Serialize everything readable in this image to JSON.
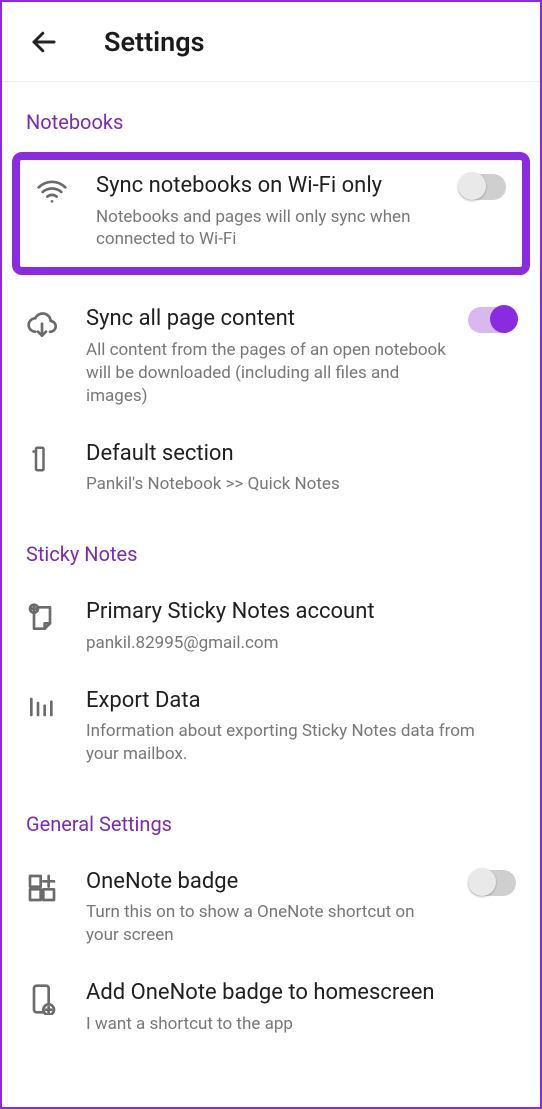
{
  "header": {
    "title": "Settings"
  },
  "sections": {
    "notebooks": {
      "header": "Notebooks",
      "sync_wifi": {
        "title": "Sync notebooks on Wi-Fi only",
        "sub": "Notebooks and pages will only sync when connected to Wi-Fi",
        "on": false
      },
      "sync_all": {
        "title": "Sync all page content",
        "sub": "All content from the pages of an open notebook will be downloaded (including all files and images)",
        "on": true
      },
      "default_section": {
        "title": "Default section",
        "sub": "Pankil's Notebook >> Quick Notes"
      }
    },
    "sticky": {
      "header": "Sticky Notes",
      "primary": {
        "title": "Primary Sticky Notes account",
        "sub": "pankil.82995@gmail.com"
      },
      "export": {
        "title": "Export Data",
        "sub": "Information about exporting Sticky Notes data from your mailbox."
      }
    },
    "general": {
      "header": "General Settings",
      "badge": {
        "title": "OneNote badge",
        "sub": "Turn this on to show a OneNote shortcut on your screen",
        "on": false
      },
      "homescreen": {
        "title": "Add OneNote badge to homescreen",
        "sub": "I want a shortcut to the app"
      }
    }
  }
}
